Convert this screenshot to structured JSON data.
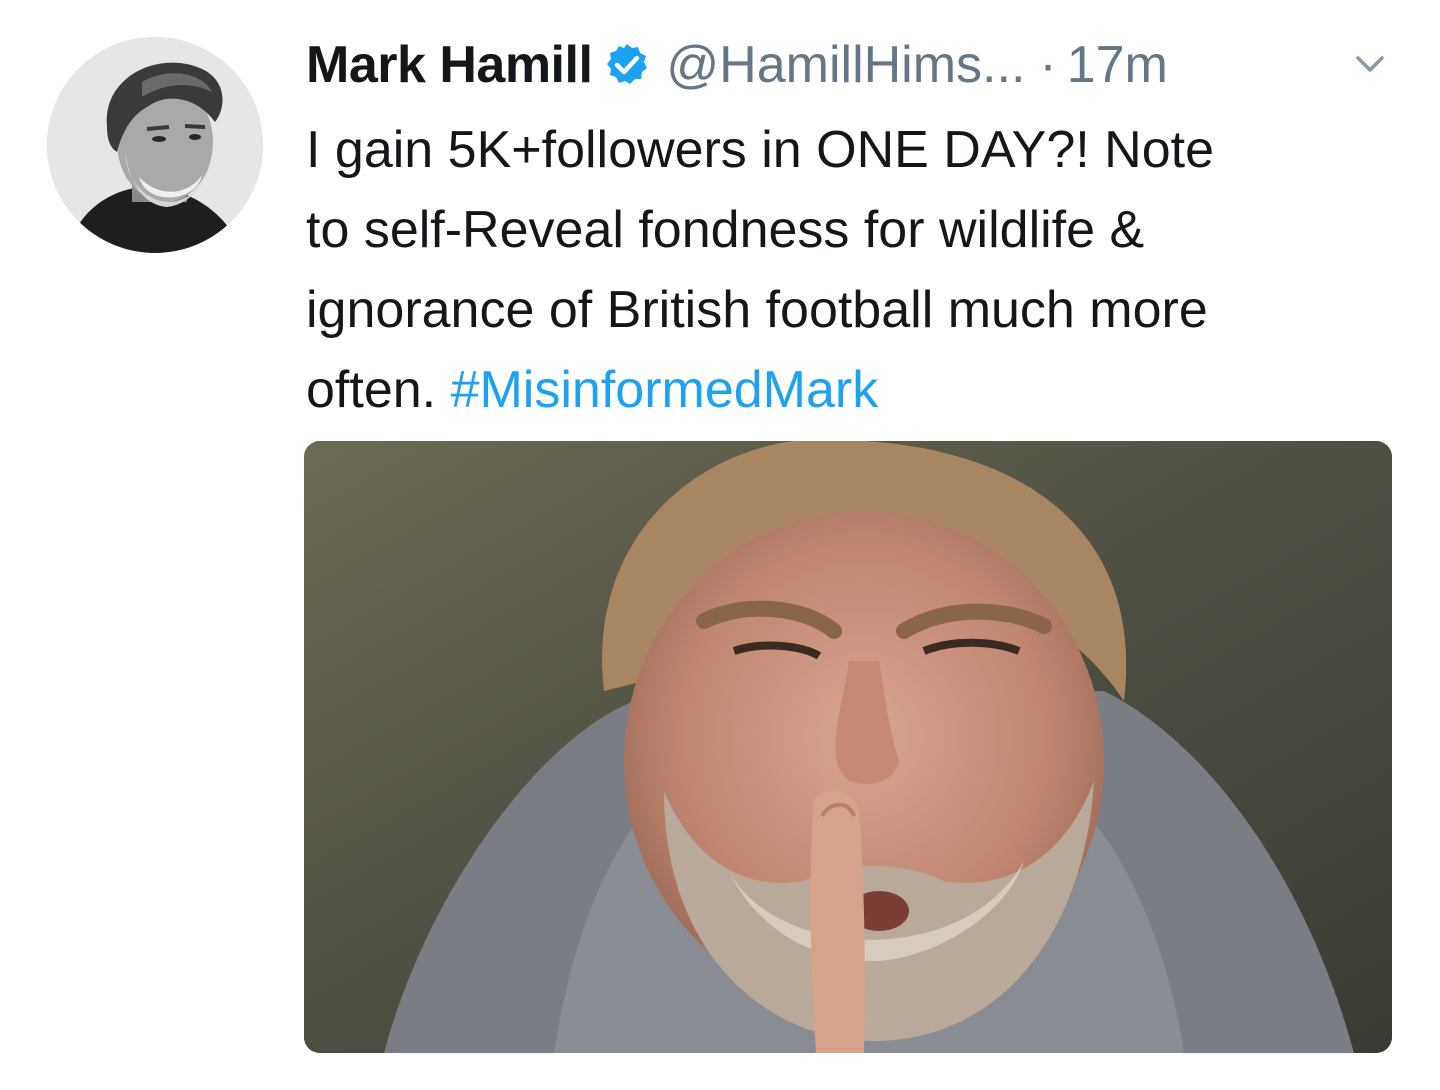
{
  "tweet": {
    "display_name": "Mark Hamill",
    "handle": "@HamillHims...",
    "separator": "·",
    "time": "17m",
    "text_lines": [
      "I gain 5K+followers in ONE DAY?! Note",
      "to self-Reveal fondness for wildlife &",
      "ignorance of British football much more"
    ],
    "text_last_line": "often.",
    "hashtag": "#MisinformedMark",
    "verified_icon": "verified-badge-icon",
    "caret_icon": "chevron-down-icon"
  },
  "colors": {
    "text": "#14171a",
    "secondary": "#657786",
    "link": "#1da1f2",
    "verified": "#1da1f2"
  }
}
